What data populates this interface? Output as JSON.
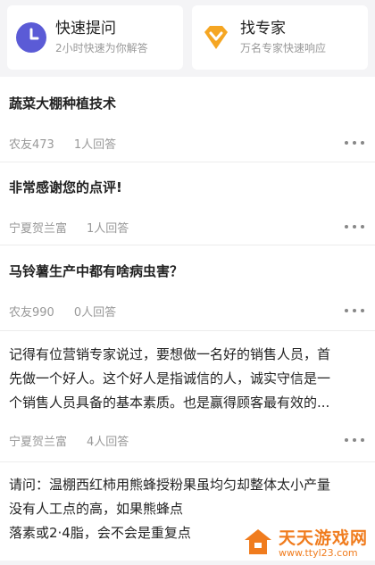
{
  "top_cards": [
    {
      "title": "快速提问",
      "subtitle": "2小时快速为你解答",
      "icon": "clock-icon",
      "color": "#5b5bd6"
    },
    {
      "title": "找专家",
      "subtitle": "万名专家快速响应",
      "icon": "diamond-icon",
      "color": "#f5a623"
    }
  ],
  "feed": [
    {
      "question": "蔬菜大棚种植技术",
      "user": "农友473",
      "answers": "1人回答"
    },
    {
      "question": "非常感谢您的点评!",
      "user": "宁夏贺兰富",
      "answers": "1人回答"
    },
    {
      "question": "马铃薯生产中都有啥病虫害？",
      "user": "农友990",
      "answers": "0人回答"
    },
    {
      "question_lines": [
        "记得有位营销专家说过，要想做一名好的销售人员，首",
        "先做一个好人。这个好人是指诚信的人，诚实守信是一",
        "个销售人员具备的基本素质。也是赢得顾客最有效的..."
      ],
      "user": "宁夏贺兰富",
      "answers": "4人回答"
    },
    {
      "question_lines": [
        "请问：温棚西红柿用熊蜂授粉果虽均匀却整体太小产量",
        "没有人工点的高，如果熊蜂点",
        "落素或2·4脂，会不会是重复点"
      ]
    }
  ],
  "watermark": {
    "main": "天天游戏网",
    "sub": "www.ttyl23.com",
    "color": "#f07c1e"
  }
}
